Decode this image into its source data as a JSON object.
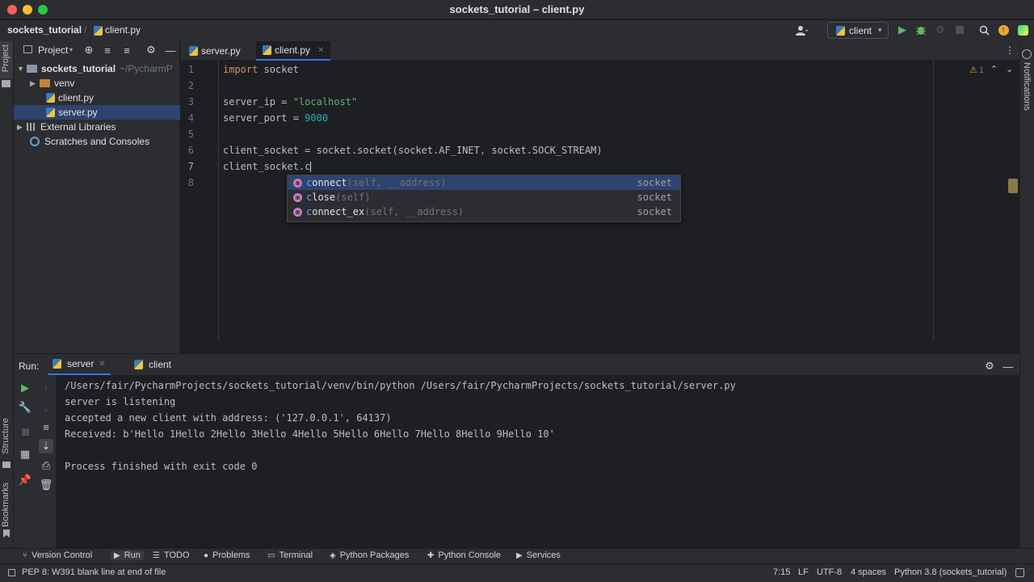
{
  "window": {
    "title": "sockets_tutorial – client.py"
  },
  "navbar": {
    "project": "sockets_tutorial",
    "file": "client.py",
    "run_config": "client"
  },
  "project_panel": {
    "title": "Project",
    "items": [
      {
        "label": "sockets_tutorial",
        "suffix": "~/PycharmP"
      },
      {
        "label": "venv"
      },
      {
        "label": "client.py"
      },
      {
        "label": "server.py"
      },
      {
        "label": "External Libraries"
      },
      {
        "label": "Scratches and Consoles"
      }
    ]
  },
  "editor": {
    "tabs": [
      {
        "label": "server.py"
      },
      {
        "label": "client.py"
      }
    ],
    "inspection_count": "1",
    "line_numbers": [
      "1",
      "2",
      "3",
      "4",
      "5",
      "6",
      "7",
      "8"
    ],
    "code": {
      "l1_kw": "import",
      "l1_rest": " socket",
      "l3_a": "server_ip = ",
      "l3_str": "\"localhost\"",
      "l4_a": "server_port = ",
      "l4_num": "9000",
      "l6_a": "client_socket = socket.socket(socket.AF_INET",
      "l6_comma": ",",
      "l6_b": " socket.SOCK_STREAM)",
      "l7": "client_socket.c"
    }
  },
  "completion": {
    "items": [
      {
        "prefix": "c",
        "rest": "onnect",
        "sig": "(self, __address)",
        "type": "socket"
      },
      {
        "prefix": "c",
        "rest": "lose",
        "sig": "(self)",
        "type": "socket"
      },
      {
        "prefix": "c",
        "rest": "onnect_ex",
        "sig": "(self, __address)",
        "type": "socket"
      }
    ]
  },
  "run_panel": {
    "label": "Run:",
    "tabs": [
      {
        "label": "server"
      },
      {
        "label": "client"
      }
    ],
    "output": [
      "/Users/fair/PycharmProjects/sockets_tutorial/venv/bin/python /Users/fair/PycharmProjects/sockets_tutorial/server.py",
      "server is listening",
      "accepted a new client with address: ('127.0.0.1', 64137)",
      "Received: b'Hello 1Hello 2Hello 3Hello 4Hello 5Hello 6Hello 7Hello 8Hello 9Hello 10'",
      "",
      "Process finished with exit code 0"
    ]
  },
  "side_labels": {
    "project": "Project",
    "structure": "Structure",
    "bookmarks": "Bookmarks",
    "notifications": "Notifications"
  },
  "bottom_tools": [
    {
      "label": "Version Control"
    },
    {
      "label": "Run"
    },
    {
      "label": "TODO"
    },
    {
      "label": "Problems"
    },
    {
      "label": "Terminal"
    },
    {
      "label": "Python Packages"
    },
    {
      "label": "Python Console"
    },
    {
      "label": "Services"
    }
  ],
  "status": {
    "message": "PEP 8: W391 blank line at end of file",
    "position": "7:15",
    "line_sep": "LF",
    "encoding": "UTF-8",
    "indent": "4 spaces",
    "interpreter": "Python 3.8 (sockets_tutorial)"
  },
  "icons": {
    "project_tool": "project-icon",
    "run": "run-icon",
    "debug": "debug-icon",
    "search": "search-icon",
    "settings": "gear-icon"
  }
}
